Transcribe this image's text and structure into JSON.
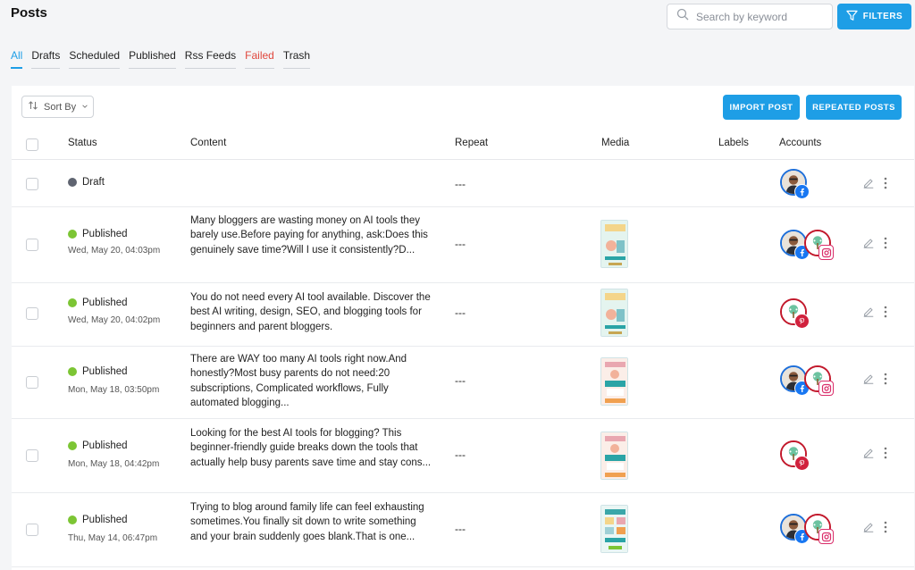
{
  "header": {
    "title": "Posts",
    "search_placeholder": "Search by keyword",
    "filters_label": "FILTERS"
  },
  "tabs": [
    {
      "label": "All"
    },
    {
      "label": "Drafts"
    },
    {
      "label": "Scheduled"
    },
    {
      "label": "Published"
    },
    {
      "label": "Rss Feeds"
    },
    {
      "label": "Failed"
    },
    {
      "label": "Trash"
    }
  ],
  "toolbar": {
    "sort_label": "Sort By",
    "import_label": "IMPORT POST",
    "repeated_label": "REPEATED POSTS"
  },
  "columns": {
    "status": "Status",
    "content": "Content",
    "repeat": "Repeat",
    "media": "Media",
    "labels": "Labels",
    "accounts": "Accounts"
  },
  "rows": [
    {
      "status": "Draft",
      "date": "",
      "content": "",
      "repeat": "---"
    },
    {
      "status": "Published",
      "date": "Wed, May 20, 04:03pm",
      "content": "Many bloggers are wasting money on AI tools they barely use.Before paying for anything, ask:Does this genuinely save time?Will I use it consistently?D...",
      "repeat": "---"
    },
    {
      "status": "Published",
      "date": "Wed, May 20, 04:02pm",
      "content": "You do not need every AI tool available. Discover the best AI writing, design, SEO, and blogging tools for beginners and parent bloggers.",
      "repeat": "---"
    },
    {
      "status": "Published",
      "date": "Mon, May 18, 03:50pm",
      "content": "There are WAY too many AI tools right now.And honestly?Most busy parents do not need:20 subscriptions, Complicated workflows, Fully automated blogging...",
      "repeat": "---"
    },
    {
      "status": "Published",
      "date": "Mon, May 18, 04:42pm",
      "content": "Looking for the best AI tools for blogging? This beginner-friendly guide breaks down the tools that actually help busy parents save time and stay cons...",
      "repeat": "---"
    },
    {
      "status": "Published",
      "date": "Thu, May 14, 06:47pm",
      "content": "Trying to blog around family life can feel exhausting sometimes.You finally sit down to write something and your brain suddenly goes blank.That is one...",
      "repeat": "---"
    }
  ],
  "colors": {
    "accent": "#1e9ee6",
    "draft_dot": "#5f6470",
    "published_dot": "#7cc534",
    "failed_tab": "#e0483e",
    "facebook": "#1877f2",
    "pinterest": "#d1213d"
  }
}
